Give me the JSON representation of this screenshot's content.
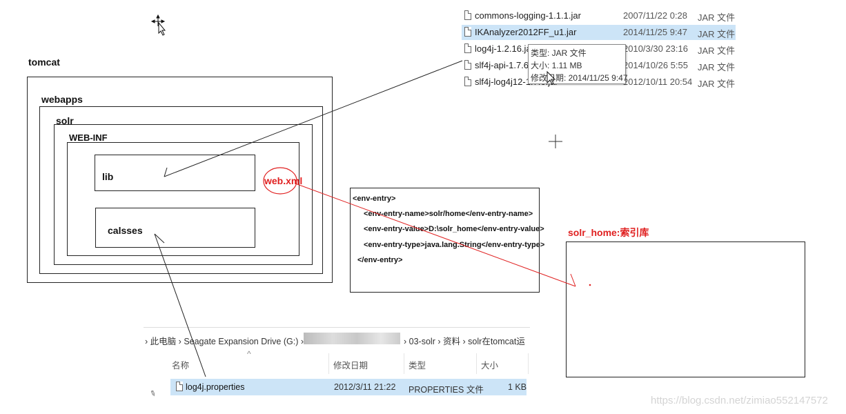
{
  "diagram": {
    "tomcat": "tomcat",
    "webapps": "webapps",
    "solr": "solr",
    "webinf": "WEB-INF",
    "lib": "lib",
    "classes": "calsses",
    "webxml": "web.xml",
    "solr_home": "solr_home:索引库"
  },
  "xml_lines": [
    "<env-entry>",
    "<env-entry-name>solr/home</env-entry-name>",
    "<env-entry-value>D:\\solr_home</env-entry-value>",
    "<env-entry-type>java.lang.String</env-entry-type>",
    "</env-entry>"
  ],
  "file_list": [
    {
      "name": "commons-logging-1.1.1.jar",
      "date": "2007/11/22 0:28",
      "type": "JAR 文件"
    },
    {
      "name": "IKAnalyzer2012FF_u1.jar",
      "date": "2014/11/25 9:47",
      "type": "JAR 文件"
    },
    {
      "name": "log4j-1.2.16.jar",
      "date": "2010/3/30 23:16",
      "type": "JAR 文件"
    },
    {
      "name": "slf4j-api-1.7.6.jar",
      "date": "2014/10/26 5:55",
      "type": "JAR 文件"
    },
    {
      "name": "slf4j-log4j12-1.7.6.jar",
      "date": "2012/10/11 20:54",
      "type": "JAR 文件"
    }
  ],
  "tooltip": {
    "type": "类型: JAR 文件",
    "size": "大小: 1.11 MB",
    "modified": "修改日期: 2014/11/25 9:47"
  },
  "explorer": {
    "breadcrumb": {
      "this_pc": "此电脑",
      "drive": "Seagate Expansion Drive (G:)",
      "folder": "03-solr",
      "sub1": "资料",
      "sub2": "solr在tomcat运"
    },
    "headers": {
      "name": "名称",
      "date": "修改日期",
      "type": "类型",
      "size": "大小"
    },
    "file": {
      "name": "log4j.properties",
      "date": "2012/3/11 21:22",
      "type": "PROPERTIES 文件",
      "size": "1 KB"
    }
  },
  "watermark": "https://blog.csdn.net/zimiao552147572",
  "colors": {
    "annotation_red": "#e02020",
    "selection_blue": "#cce4f7"
  },
  "icons": [
    "move-cursor-icon",
    "crosshair-cursor-icon",
    "file-icon",
    "pin-icon",
    "sort-arrow-icon"
  ]
}
